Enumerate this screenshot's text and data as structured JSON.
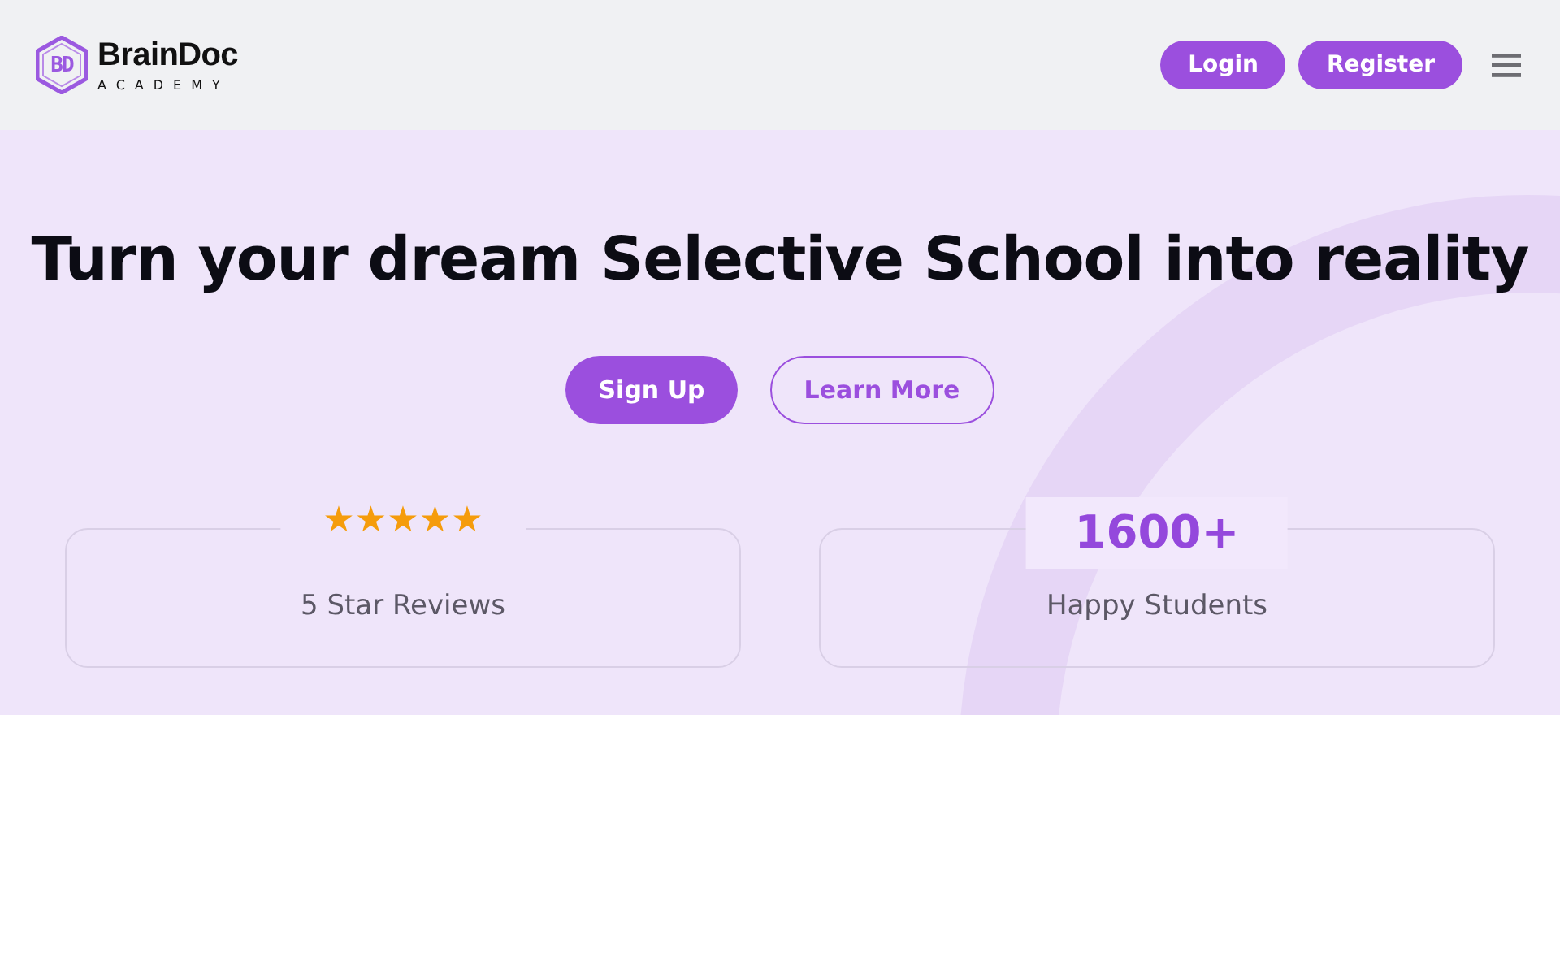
{
  "header": {
    "logo_mark": "BD",
    "logo_name": "BrainDoc",
    "logo_sub": "ACADEMY",
    "buttons": [
      "Login",
      "Register"
    ]
  },
  "hero": {
    "title": "Turn your dream Selective School into reality",
    "buttons": [
      {
        "label": "Sign Up",
        "kind": "filled"
      },
      {
        "label": "Learn More",
        "kind": "outline"
      }
    ],
    "stats": [
      {
        "kind": "stars",
        "stars": 5,
        "label": "5 Star Reviews"
      },
      {
        "kind": "number",
        "value": "1600+",
        "label": "Happy Students"
      }
    ]
  }
}
